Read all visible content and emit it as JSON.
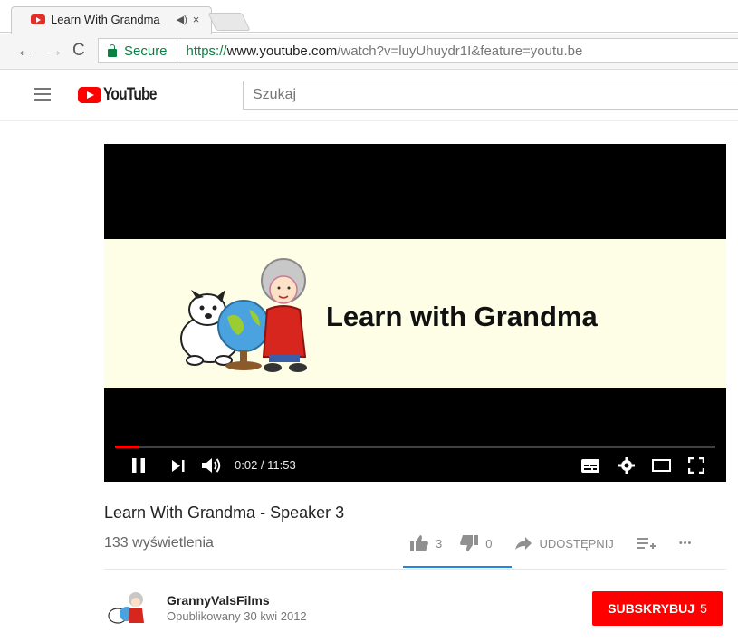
{
  "browser": {
    "tab_title": "Learn With Grandma",
    "audio_icon": "speaker-icon",
    "close_glyph": "×",
    "secure_label": "Secure",
    "url_scheme": "https://",
    "url_host": "www.youtube.com",
    "url_rest": "/watch?v=luyUhuydr1I&feature=youtu.be"
  },
  "masthead": {
    "logo_text": "YouTube",
    "search_placeholder": "Szukaj"
  },
  "player": {
    "banner_title": "Learn with Grandma",
    "time_display": "0:02 / 11:53",
    "progress_fraction": 0.003
  },
  "video": {
    "title": "Learn With Grandma - Speaker 3",
    "views": "133 wyświetlenia",
    "likes": "3",
    "dislikes": "0",
    "share_label": "UDOSTĘPNIJ",
    "more_glyph": "•••"
  },
  "owner": {
    "channel_name": "GrannyValsFilms",
    "published": "Opublikowany 30 kwi 2012",
    "subscribe_label": "SUBSKRYBUJ",
    "subscriber_count": "5"
  },
  "colors": {
    "brand_red": "#ff0000",
    "secure_green": "#0b8043",
    "accent_blue": "#1e88e5"
  }
}
